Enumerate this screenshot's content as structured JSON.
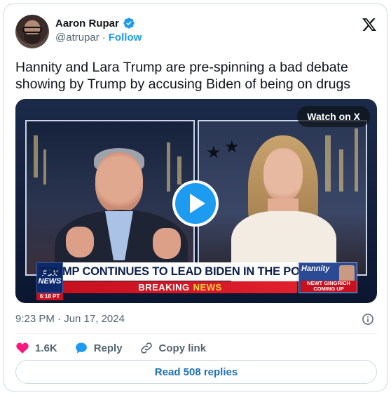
{
  "author": {
    "name": "Aaron Rupar",
    "handle": "@atrupar",
    "separator": "·",
    "follow_label": "Follow"
  },
  "tweet": {
    "text": "Hannity and Lara Trump are pre-spinning a bad debate showing by Trump by accusing Biden of being on drugs",
    "timestamp": "9:23 PM · Jun 17, 2024"
  },
  "media": {
    "watch_label": "Watch on X",
    "chyron_headline": "TRUMP CONTINUES TO LEAD BIDEN IN THE POLLS",
    "chyron_breaking": "BREAKING",
    "chyron_news": "NEWS",
    "network_logo_line1": "FOX",
    "network_logo_line2": "NEWS",
    "network_time": "6:18 PT",
    "show_name": "Hannity",
    "show_caption_line1": "NEWT GINGRICH",
    "show_caption_line2": "COMING UP"
  },
  "actions": {
    "likes_count": "1.6K",
    "reply_label": "Reply",
    "copy_link_label": "Copy link"
  },
  "read_replies_label": "Read 508 replies",
  "colors": {
    "accent": "#1d9bf0",
    "like": "#f91880",
    "text_secondary": "#536471"
  },
  "icons": [
    "verified-badge-icon",
    "x-logo-icon",
    "play-icon",
    "info-icon",
    "heart-icon",
    "reply-bubble-icon",
    "link-icon"
  ]
}
